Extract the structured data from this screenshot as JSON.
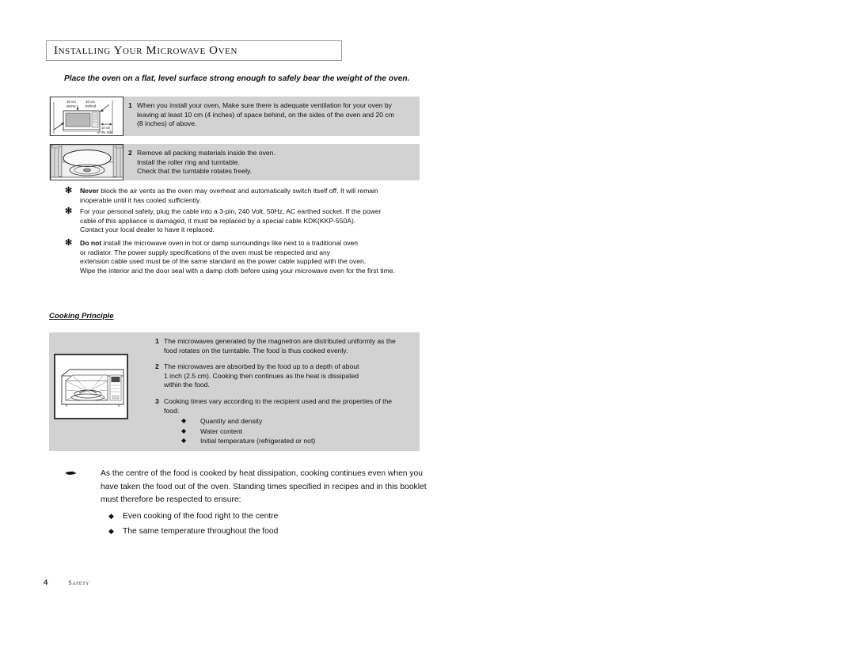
{
  "header": {
    "title": "Installing Your Microwave Oven"
  },
  "intro": {
    "text": "Place the oven on a flat, level surface strong enough to safely bear the weight of the oven."
  },
  "install_steps": [
    {
      "number": "1",
      "lines": [
        "When you install your oven, Make sure there is adequate ventilation for your oven by",
        "leaving at least 10 cm (4 inches) of space behind, on the sides of the oven and 20 cm",
        "(8 inches) of above."
      ],
      "figure": {
        "name": "oven-clearance-diagram",
        "labels": [
          "20 cm",
          "above",
          "10 cm",
          "behind",
          "10 cm",
          "of the side"
        ]
      }
    },
    {
      "number": "2",
      "lines": [
        "Remove all packing materials inside the oven.",
        "Install the roller ring and turntable.",
        "Check that the turntable rotates freely."
      ],
      "figure": {
        "name": "oven-turntable-diagram",
        "labels": []
      }
    }
  ],
  "notes": [
    {
      "mark": "snowflake-bullet",
      "lead": "Never",
      "lines": [
        " block the air vents as the oven may overheat and automatically switch itself off. It will remain",
        "inoperable until it has cooled sufficiently."
      ]
    },
    {
      "mark": "snowflake-bullet",
      "lead": "",
      "lines": [
        "For your personal safety, plug the cable into a 3-pin, 240 Volt, 50Hz, AC earthed socket. If the power",
        "cable of this appliance is damaged, it must be replaced by a special cable KDK(KKP-550A).",
        "Contact your local dealer to have it replaced."
      ]
    },
    {
      "mark": "snowflake-bullet",
      "lead": "Do not",
      "lines": [
        " install the microwave oven in hot or damp surroundings like next to a traditional oven",
        "or radiator. The power supply specifications of the oven must be respected and any",
        "extension cable used must be of the same standard as the power cable supplied with the oven.",
        "Wipe the interior and the door seal with a damp cloth before using your microwave oven for the first time."
      ]
    }
  ],
  "cooking_principle": {
    "heading": "Cooking Principle",
    "figure": {
      "name": "microwave-oven-cutaway-diagram"
    },
    "steps": [
      {
        "number": "1",
        "lines": [
          "The microwaves generated by the magnetron are distributed uniformly as the",
          "food rotates on the turntable. The food is thus cooked evenly."
        ],
        "bullets": []
      },
      {
        "number": "2",
        "lines": [
          "The microwaves are absorbed by the food up to a depth of about",
          "1 inch (2.5 cm). Cooking then continues as the heat is dissipated",
          "within the food."
        ],
        "bullets": []
      },
      {
        "number": "3",
        "lines": [
          "Cooking times vary according to the recipient used and the properties of the",
          "food:"
        ],
        "bullets": [
          "Quantity and density",
          "Water content",
          "Initial temperature (refrigerated or not)"
        ]
      }
    ]
  },
  "hand_note": {
    "icon": "pointing-hand-icon",
    "lines": [
      "As the centre of the food is cooked by heat dissipation, cooking continues even when you",
      "have taken the food out of the oven. Standing times specified in recipes and in this booklet",
      "must therefore be respected to ensure:"
    ],
    "bullets": [
      "Even cooking of the food right to the centre",
      "The same temperature throughout the food"
    ]
  },
  "footer": {
    "page_number": "4",
    "section_label": "Safety"
  },
  "colors": {
    "block_gray": "#d2d2d2",
    "text": "#111111",
    "border_gray": "#9a9a9a"
  }
}
